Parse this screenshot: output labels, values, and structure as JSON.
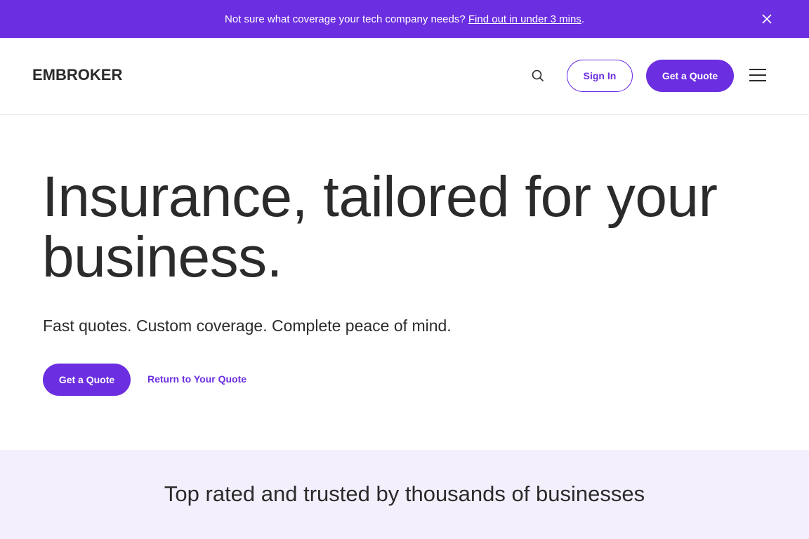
{
  "announcement": {
    "text": "Not sure what coverage your tech company needs?",
    "link": "Find out in under 3 mins",
    "suffix": "."
  },
  "header": {
    "logo": "EMBROKER",
    "sign_in": "Sign In",
    "get_quote": "Get a Quote"
  },
  "hero": {
    "title": "Insurance, tailored for your business.",
    "subtitle": "Fast quotes. Custom coverage. Complete peace of mind.",
    "cta": "Get a Quote",
    "secondary_link": "Return to Your Quote"
  },
  "trusted": {
    "heading": "Top rated and trusted by thousands of businesses"
  },
  "colors": {
    "brand": "#6b2ee0",
    "text": "#2b2b2b",
    "section_bg": "#f3effc"
  }
}
